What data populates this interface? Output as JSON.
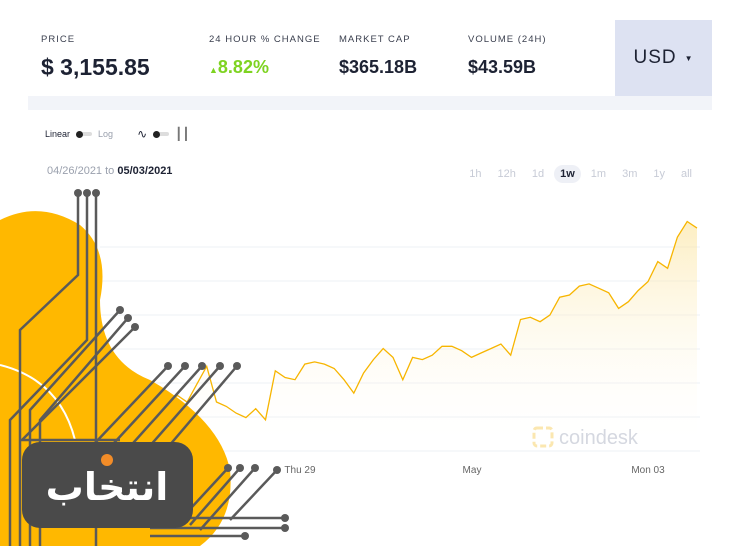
{
  "stats": {
    "price": {
      "label": "PRICE",
      "value": "$ 3,155.85"
    },
    "change": {
      "label": "24 HOUR % CHANGE",
      "value": "8.82%",
      "direction": "up",
      "color": "#7ed321"
    },
    "market_cap": {
      "label": "MARKET CAP",
      "value": "$365.18B"
    },
    "volume": {
      "label": "VOLUME (24H)",
      "value": "$43.59B"
    }
  },
  "currency": {
    "selected": "USD"
  },
  "toggles": {
    "linear": "Linear",
    "log": "Log"
  },
  "date_range": {
    "from": "04/26/2021",
    "to_word": "to",
    "to": "05/03/2021"
  },
  "ranges": [
    "1h",
    "12h",
    "1d",
    "1w",
    "1m",
    "3m",
    "1y",
    "all"
  ],
  "active_range": "1w",
  "watermark": "coindesk",
  "logo_text": "انتخاب",
  "chart_data": {
    "type": "area",
    "x_tick_labels": [
      "Thu 29",
      "May",
      "Mon 03"
    ],
    "line_color": "#f7b500",
    "grid": true,
    "values": [
      2480,
      2500,
      2530,
      2560,
      2540,
      2600,
      2650,
      2620,
      2640,
      2680,
      2670,
      2660,
      2640,
      2610,
      2650,
      2620,
      2700,
      2780,
      2620,
      2600,
      2570,
      2550,
      2590,
      2540,
      2760,
      2730,
      2720,
      2790,
      2800,
      2790,
      2770,
      2720,
      2660,
      2750,
      2810,
      2860,
      2820,
      2720,
      2820,
      2810,
      2830,
      2870,
      2870,
      2850,
      2820,
      2840,
      2860,
      2880,
      2830,
      2990,
      3000,
      2980,
      3010,
      3090,
      3100,
      3140,
      3150,
      3130,
      3110,
      3040,
      3070,
      3120,
      3160,
      3250,
      3220,
      3360,
      3430,
      3400
    ]
  }
}
